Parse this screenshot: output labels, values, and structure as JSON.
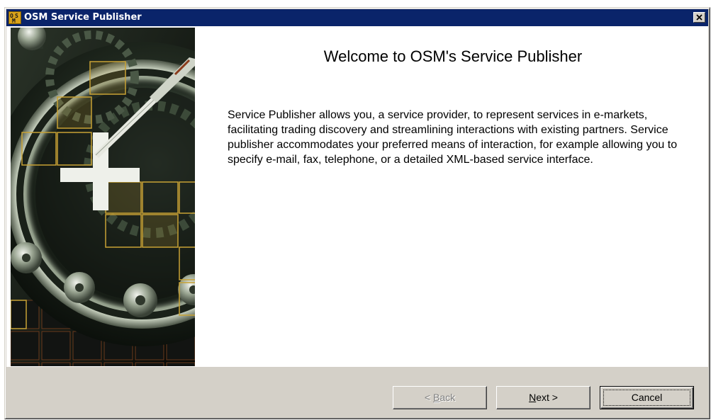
{
  "window": {
    "title": "OSM Service Publisher",
    "icon": "osm-app-icon",
    "close_icon": "close-icon"
  },
  "welcome": {
    "title": "Welcome to OSM's Service Publisher",
    "description": "Service Publisher allows you, a service provider, to represent services in e-markets, facilitating trading discovery and streamlining interactions with existing partners. Service publisher accommodates your preferred means of interaction, for example allowing you to specify e-mail, fax, telephone, or a detailed XML-based service interface."
  },
  "buttons": {
    "back": {
      "prefix": "< ",
      "accel": "B",
      "rest": "ack",
      "enabled": false
    },
    "next": {
      "accel": "N",
      "rest": "ext >",
      "enabled": true
    },
    "cancel": {
      "label": "Cancel",
      "enabled": true,
      "default": true
    }
  },
  "colors": {
    "titlebar": "#0a246a",
    "face": "#d4d0c8",
    "icon_gold": "#d9a21b",
    "art_highlight": "#c8a235"
  }
}
